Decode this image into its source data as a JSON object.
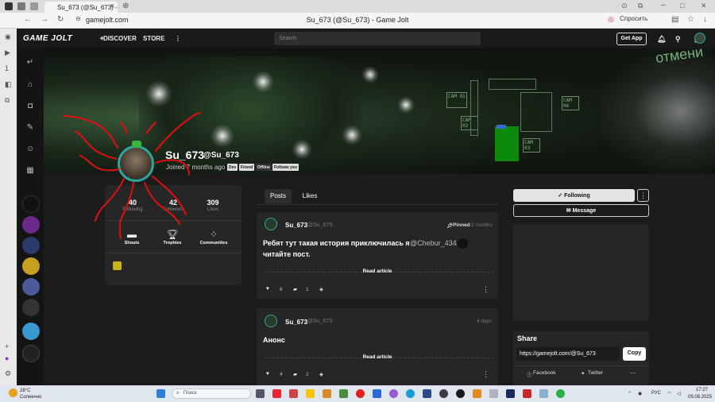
{
  "browser": {
    "tab_title": "Su_673 (@Su_673) - Ga",
    "url": "gamejolt.com",
    "page_title": "Su_673 (@Su_673) - Game Jolt",
    "ask_label": "Спросить"
  },
  "header": {
    "logo": "GAME JOLT",
    "discover": "DISCOVER",
    "store": "STORE",
    "search_placeholder": "Search",
    "get_app": "Get App"
  },
  "profile": {
    "name": "Su_673",
    "handle": "@Su_673",
    "joined": "Joined 7 months ago",
    "badges": [
      "Dev",
      "Friend",
      "Offline",
      "Follows you"
    ],
    "stats": [
      {
        "value": "40",
        "label": "Following"
      },
      {
        "value": "42",
        "label": "Followers"
      },
      {
        "value": "309",
        "label": "Likes"
      }
    ],
    "quick_links": [
      "Shouts",
      "Trophies",
      "Communities"
    ]
  },
  "tabs": [
    "Posts",
    "Likes"
  ],
  "posts": [
    {
      "author": "Su_673",
      "handle": "@Su_673",
      "pinned": "Pinned",
      "time": "2 months",
      "text_line1": "Ребят тут такая история приключилась я",
      "mention": "@Chebur_434",
      "text_line2": "читайте пост.",
      "read": "Read article",
      "likes": "6",
      "comments": "1"
    },
    {
      "author": "Su_673",
      "handle": "@Su_673",
      "time": "4 days",
      "text_line1": "Анонс",
      "read": "Read article",
      "likes": "4",
      "comments": "2"
    }
  ],
  "sidebar": {
    "following": "Following",
    "message": "Message",
    "share_title": "Share",
    "share_url": "https://gamejolt.com/@Su_673",
    "copy": "Copy",
    "facebook": "Facebook",
    "twitter": "Twitter"
  },
  "banner": {
    "cams": [
      "CAM 01",
      "CAM 02",
      "CAM 03",
      "CAM 06"
    ],
    "overlay_text": "отмени"
  },
  "taskbar": {
    "temp": "28°C",
    "weather": "Солнечно",
    "search": "Поиск",
    "lang": "РУС",
    "time": "17:27",
    "date": "09.08.2025"
  }
}
